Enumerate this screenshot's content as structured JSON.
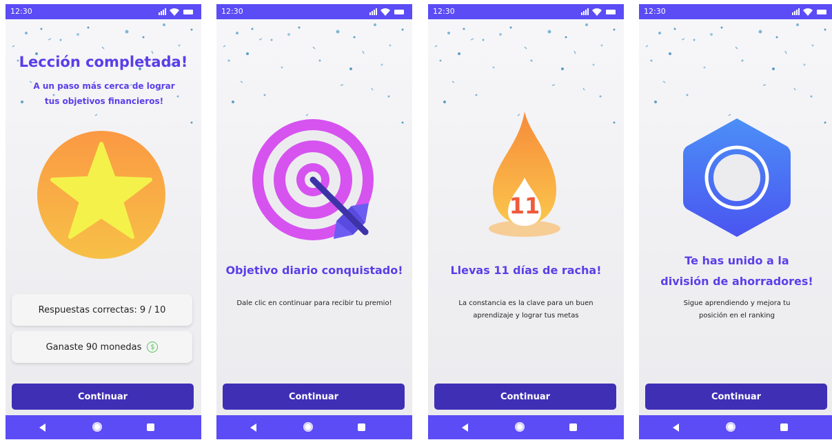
{
  "status_time": "12:30",
  "screens": [
    {
      "title": "Lección completada!",
      "subtitle": "A un paso más cerca de lograr tus objetivos financieros!",
      "cards": [
        "Respuestas correctas: 9 / 10",
        "Ganaste 90 monedas"
      ],
      "button": "Continuar",
      "icons": {
        "art": "star-badge",
        "coin": "coin-icon"
      },
      "coin_symbol": "$"
    },
    {
      "title": "Objetivo diario conquistado!",
      "description": "Dale clic en continuar para recibir tu premio!",
      "button": "Continuar",
      "icons": {
        "art": "target-with-arrow"
      }
    },
    {
      "title": "Llevas 11 días de racha!",
      "description": "La constancia es la clave para un buen aprendizaje y lograr tus metas",
      "streak_number": "11",
      "button": "Continuar",
      "icons": {
        "art": "flame"
      }
    },
    {
      "title_line1": "Te has unido a la",
      "title_line2": "división de ahorradores!",
      "description": "Sigue aprendiendo y mejora tu posición en el ranking",
      "button": "Continuar",
      "icons": {
        "art": "hexagon-division-badge"
      }
    }
  ],
  "colors": {
    "status_bar": "#5b4cf5",
    "title": "#5b3ee8",
    "button": "#3f2fb5",
    "star": "#f4f24a",
    "target": "#d653f0",
    "flame": "#f9a23a",
    "hexagon": "#4a6af5"
  }
}
